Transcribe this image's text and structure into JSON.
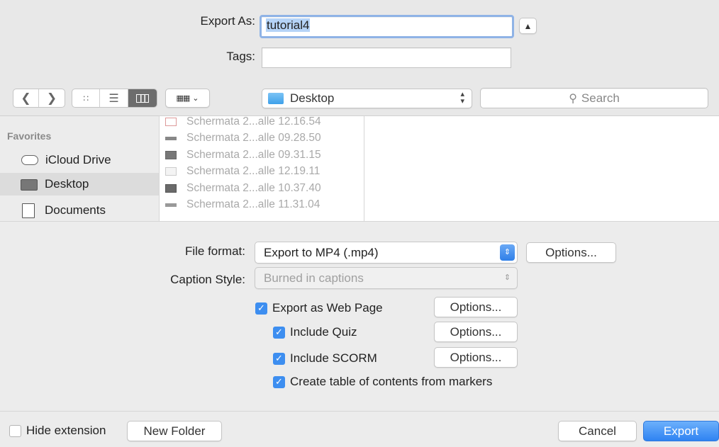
{
  "header": {
    "export_as_label": "Export As:",
    "export_as_value": "tutorial4",
    "tags_label": "Tags:",
    "tags_value": "",
    "collapse_icon": "chevron-up-icon"
  },
  "toolbar": {
    "back_icon": "chevron-left-icon",
    "forward_icon": "chevron-right-icon",
    "view_modes": [
      "icon-view",
      "list-view",
      "column-view"
    ],
    "selected_view": "column-view",
    "arrange_icon": "arrange-grid-icon",
    "location": "Desktop",
    "search_placeholder": "Search"
  },
  "sidebar": {
    "section": "Favorites",
    "items": [
      {
        "label": "iCloud Drive",
        "icon": "cloud-icon",
        "active": false
      },
      {
        "label": "Desktop",
        "icon": "desktop-icon",
        "active": true
      },
      {
        "label": "Documents",
        "icon": "documents-icon",
        "active": false
      }
    ]
  },
  "files": [
    "Schermata 2...alle 12.16.54",
    "Schermata 2...alle 09.28.50",
    "Schermata 2...alle 09.31.15",
    "Schermata 2...alle 12.19.11",
    "Schermata 2...alle 10.37.40",
    "Schermata 2...alle 11.31.04"
  ],
  "options": {
    "file_format_label": "File format:",
    "file_format_value": "Export to MP4 (.mp4)",
    "options_label": "Options...",
    "caption_style_label": "Caption Style:",
    "caption_style_value": "Burned in captions",
    "checkboxes": {
      "web_page": "Export as Web Page",
      "quiz": "Include Quiz",
      "scorm": "Include SCORM",
      "toc": "Create table of contents from markers"
    }
  },
  "footer": {
    "hide_extension": "Hide extension",
    "new_folder": "New Folder",
    "cancel": "Cancel",
    "export": "Export"
  },
  "colors": {
    "accent": "#3d8ef0",
    "selection": "#b5d3f7"
  }
}
